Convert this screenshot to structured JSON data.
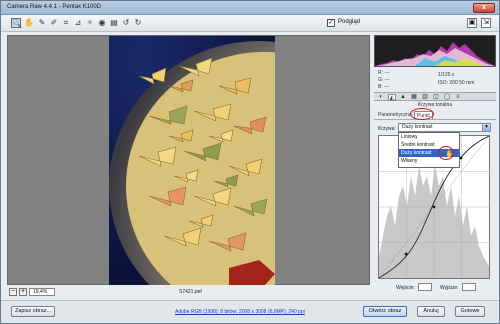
{
  "window": {
    "title": "Camera Raw 4.4.1  -  Pentax K100D",
    "close_label": "x"
  },
  "toolbar": {
    "tools": [
      {
        "name": "zoom-icon",
        "glyph": "🔍"
      },
      {
        "name": "hand-icon",
        "glyph": "✋"
      },
      {
        "name": "white-balance-icon",
        "glyph": "✎"
      },
      {
        "name": "color-sampler-icon",
        "glyph": "✐"
      },
      {
        "name": "crop-icon",
        "glyph": "⌗"
      },
      {
        "name": "straighten-icon",
        "glyph": "⊿"
      },
      {
        "name": "retouch-icon",
        "glyph": "✧"
      },
      {
        "name": "red-eye-icon",
        "glyph": "◉"
      },
      {
        "name": "preferences-icon",
        "glyph": "▤"
      },
      {
        "name": "rotate-left-icon",
        "glyph": "↺"
      },
      {
        "name": "rotate-right-icon",
        "glyph": "↻"
      }
    ],
    "preview_checked": "✓",
    "preview_label": "Podgląd",
    "fullscreen_glyph": "▣",
    "external_glyph": "⇲"
  },
  "canvas": {
    "zoom_minus": "−",
    "zoom_plus": "+",
    "zoom_value": "19,4%",
    "filename": "S7421.pef"
  },
  "panel": {
    "readout_r": "R:  ---",
    "readout_g": "G:  ---",
    "readout_b": "B:  ---",
    "shutter": "1/125 s",
    "iso_focal": "ISO: 200    50 mm",
    "tabs": [
      {
        "name": "basic-tab-icon",
        "glyph": "◐"
      },
      {
        "name": "tone-curve-tab-icon",
        "glyph": "◭"
      },
      {
        "name": "detail-tab-icon",
        "glyph": "▲"
      },
      {
        "name": "hsl-tab-icon",
        "glyph": "▦"
      },
      {
        "name": "split-toning-tab-icon",
        "glyph": "▥"
      },
      {
        "name": "lens-tab-icon",
        "glyph": "◫"
      },
      {
        "name": "camera-calibration-tab-icon",
        "glyph": "◯"
      },
      {
        "name": "presets-tab-icon",
        "glyph": "≡"
      }
    ],
    "section_title": "Krzywa tonalna",
    "subtab_parametric": "Parametryczna",
    "subtab_point": "Punkt",
    "curve_label": "Krzywa:",
    "curve_value": "Duży kontrast",
    "curve_options": [
      "Liniowy",
      "Średni kontrast",
      "Duży kontrast",
      "Własny"
    ],
    "input_label": "Wejście:",
    "output_label": "Wyjście:"
  },
  "footer": {
    "save_label": "Zapisz obraz...",
    "workflow_link": "Adobe RGB (1998); 8 bitów; 2008 x 3008 (6,0MP); 240 ppi",
    "open_label": "Otwórz obraz",
    "cancel_label": "Anuluj",
    "done_label": "Gotowe"
  },
  "colors": {
    "dropdown_highlight": "#2f63c8",
    "annotation_circle": "#d21c1c",
    "link": "#1a3cb8"
  }
}
